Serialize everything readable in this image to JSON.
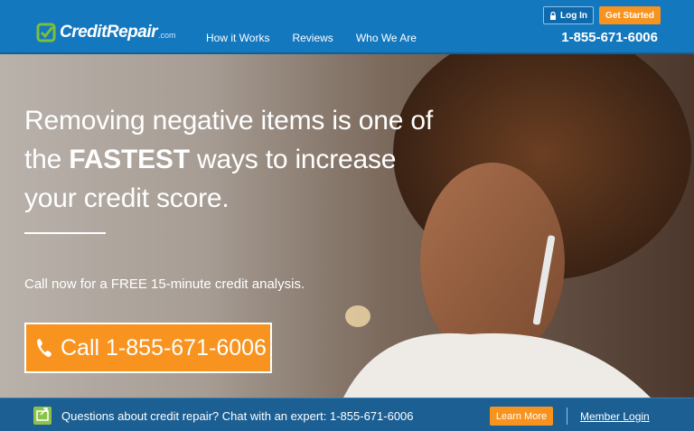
{
  "header": {
    "logo_text": "CreditRepair",
    "logo_suffix": ".com",
    "nav": [
      "How it Works",
      "Reviews",
      "Who We Are"
    ],
    "login_label": "Log In",
    "start_label": "Get Started",
    "phone": "1-855-671-6006"
  },
  "hero": {
    "headline_part1": "Removing negative items is one of the ",
    "headline_bold": "FASTEST",
    "headline_part2": " ways to increase your credit score.",
    "subline": "Call now for a FREE 15-minute credit analysis.",
    "call_label": "Call 1-855-671-6006"
  },
  "bottombar": {
    "chat_text": "Questions about credit repair? Chat with an expert: 1-855-671-6006",
    "learn_label": "Learn More",
    "member_login": "Member Login"
  },
  "colors": {
    "brand_blue": "#1378be",
    "accent_orange": "#f7931e",
    "logo_green": "#7bbf3b"
  },
  "icons": [
    "logo-check-icon",
    "lock-icon",
    "phone-icon",
    "chat-icon"
  ]
}
